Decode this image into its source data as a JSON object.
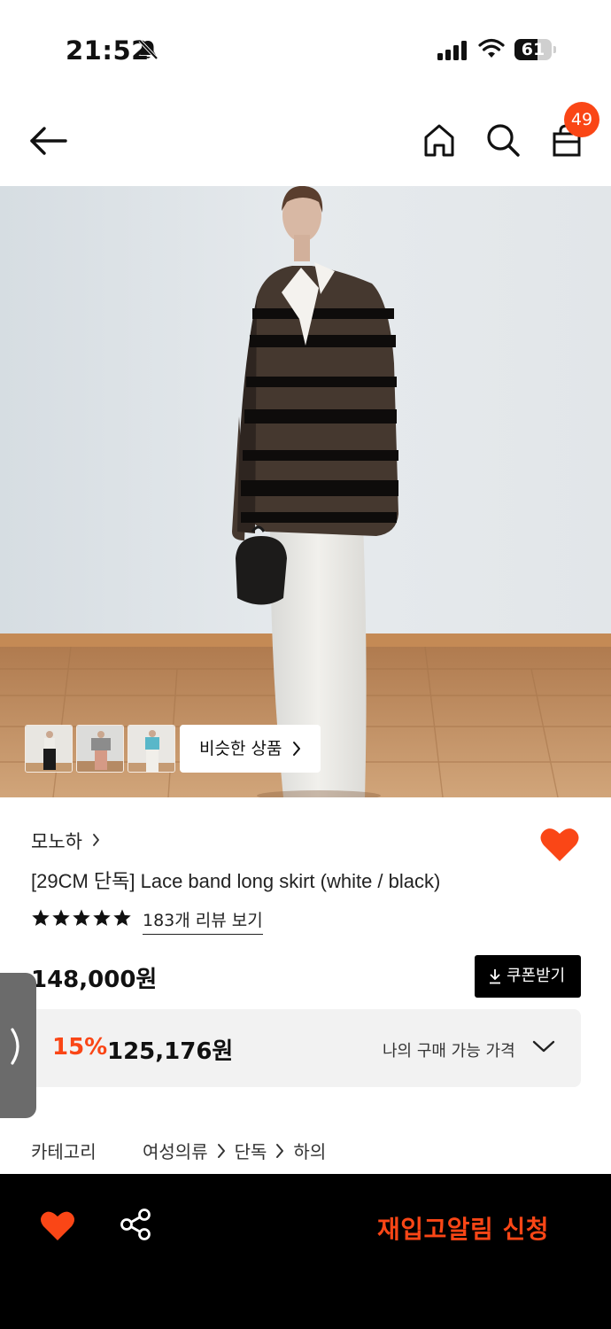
{
  "status_bar": {
    "time": "21:52",
    "battery_percent": "61",
    "battery_level": 0.61
  },
  "header": {
    "cart_count": "49",
    "icons": [
      "back-arrow-icon",
      "home-icon",
      "search-icon",
      "cart-icon"
    ]
  },
  "gallery": {
    "thumbnail_count": 3,
    "similar_products_label": "비슷한 상품"
  },
  "product": {
    "brand": "모노하",
    "title": "[29CM 단독] Lace band long skirt (white / black)",
    "rating_stars": 5,
    "review_link": "183개 리뷰 보기",
    "original_price": "148,000원",
    "coupon_label": "쿠폰받기",
    "discount_rate": "15%",
    "sale_price": "125,176원",
    "my_price_label": "나의 구매 가능 가격",
    "liked": true
  },
  "category": {
    "label": "카테고리",
    "path": [
      "여성의류",
      "단독",
      "하의"
    ]
  },
  "bottom_bar": {
    "restock_label": "재입고알림 신청"
  },
  "colors": {
    "accent": "#fa4616",
    "bottom_bar": "#000000",
    "price_box": "#f2f2f2"
  }
}
